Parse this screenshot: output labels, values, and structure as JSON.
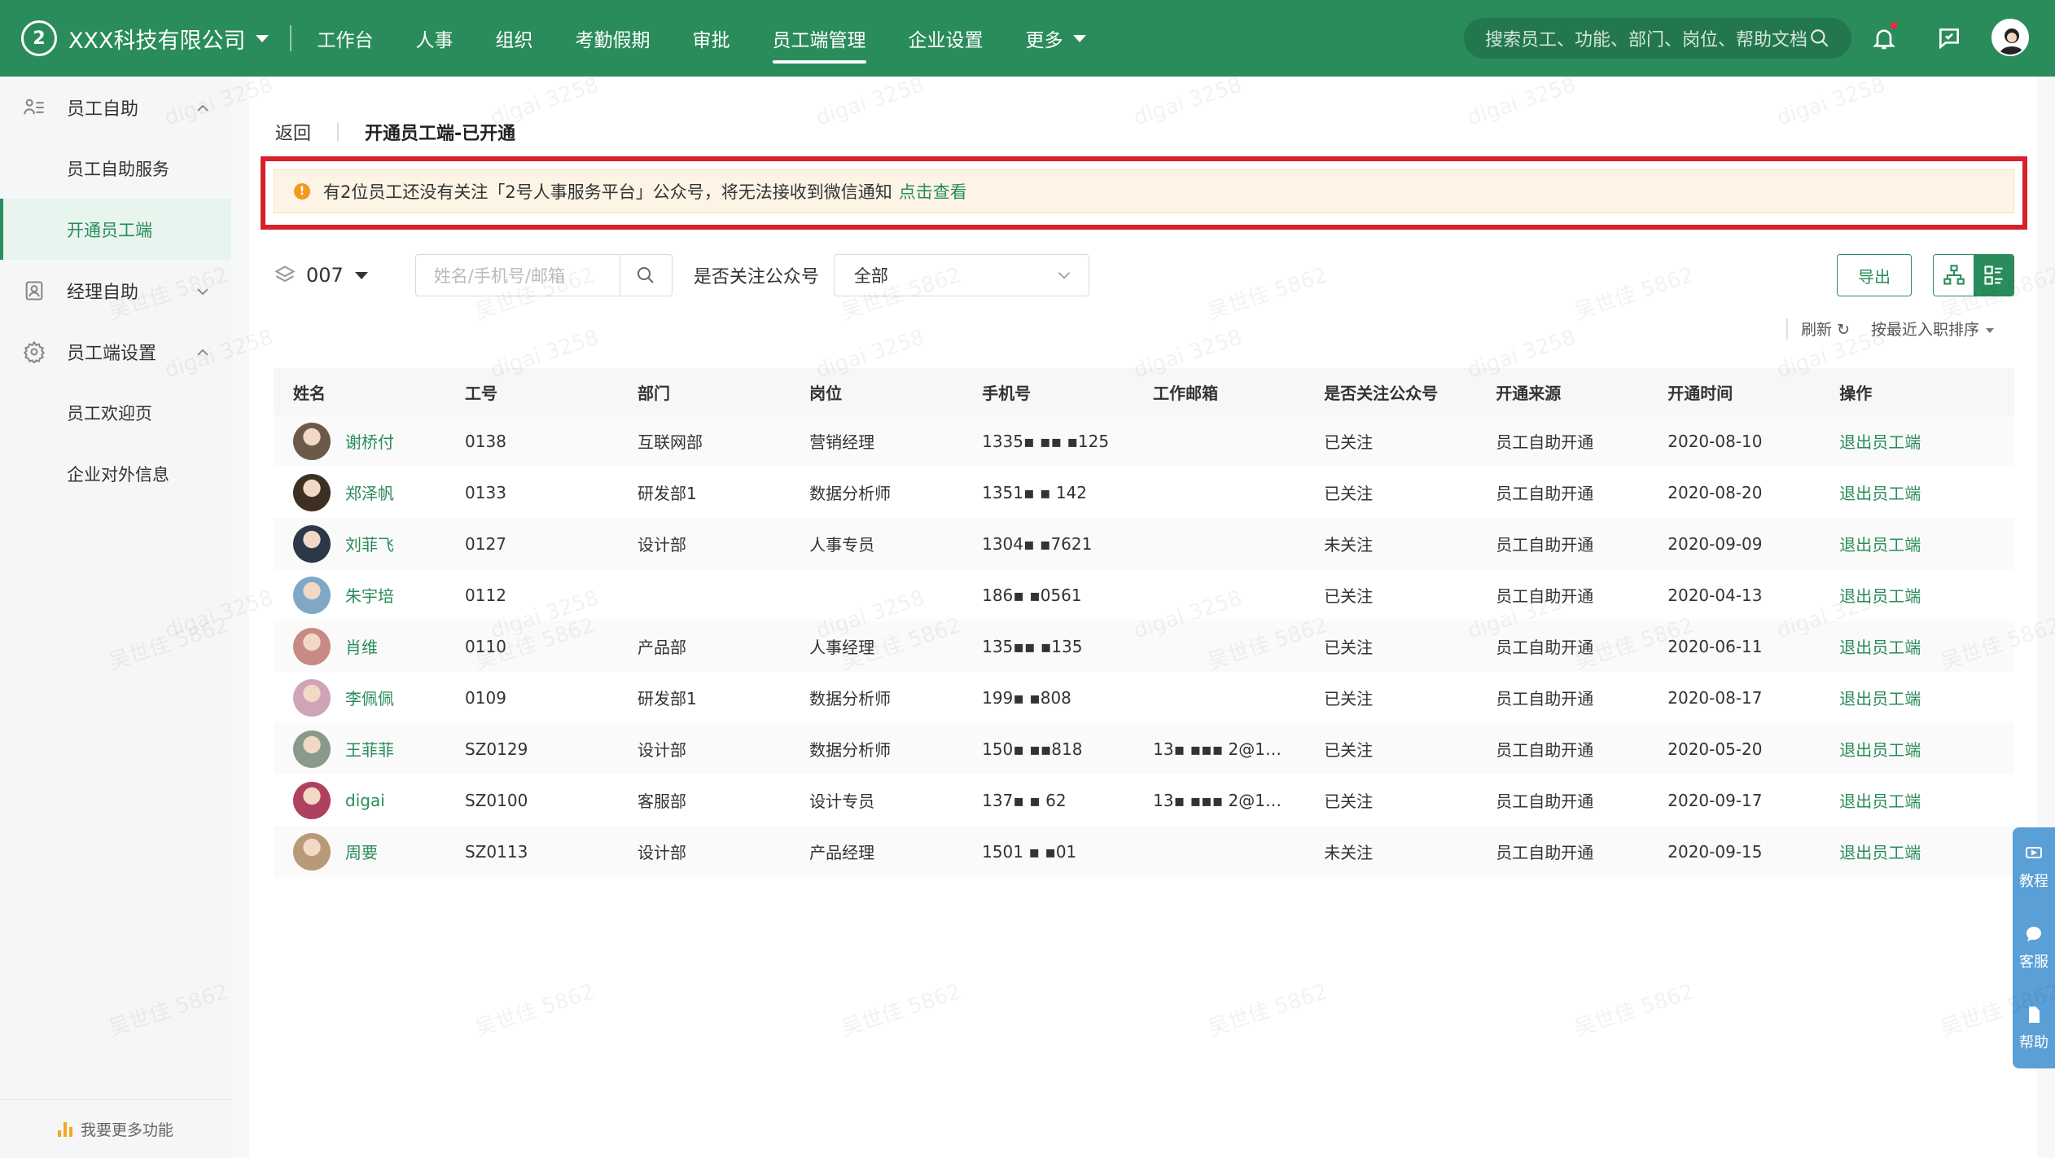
{
  "topbar": {
    "logo_text": "2",
    "company": "XXX科技有限公司",
    "nav": [
      "工作台",
      "人事",
      "组织",
      "考勤假期",
      "审批",
      "员工端管理",
      "企业设置",
      "更多"
    ],
    "active_nav": "员工端管理",
    "search_placeholder": "搜索员工、功能、部门、岗位、帮助文档"
  },
  "sidebar": {
    "groups": [
      {
        "label": "员工自助",
        "icon": "user-list-icon",
        "expanded": true,
        "items": [
          "员工自助服务",
          "开通员工端"
        ]
      },
      {
        "label": "经理自助",
        "icon": "manager-icon",
        "expanded": false,
        "items": []
      },
      {
        "label": "员工端设置",
        "icon": "gear-icon",
        "expanded": true,
        "items": [
          "员工欢迎页",
          "企业对外信息"
        ]
      }
    ],
    "active_item": "开通员工端",
    "bottom_link": "我要更多功能"
  },
  "page": {
    "back": "返回",
    "title": "开通员工端-已开通",
    "alert_text": "有2位员工还没有关注「2号人事服务平台」公众号，将无法接收到微信通知",
    "alert_link": "点击查看",
    "dept_value": "007",
    "name_placeholder": "姓名/手机号/邮箱",
    "follow_label": "是否关注公众号",
    "follow_value": "全部",
    "export_label": "导出",
    "refresh_label": "刷新",
    "sort_label": "按最近入职排序"
  },
  "table": {
    "headers": [
      "姓名",
      "工号",
      "部门",
      "岗位",
      "手机号",
      "工作邮箱",
      "是否关注公众号",
      "开通来源",
      "开通时间",
      "操作"
    ],
    "rows": [
      {
        "name": "谢桥付",
        "id": "0138",
        "dept": "互联网部",
        "post": "营销经理",
        "phone": "1335▪ ▪▪ ▪125",
        "email": "",
        "follow": "已关注",
        "source": "员工自助开通",
        "date": "2020-08-10",
        "op": "退出员工端",
        "avatar": "#6b5a4a"
      },
      {
        "name": "郑泽帆",
        "id": "0133",
        "dept": "研发部1",
        "post": "数据分析师",
        "phone": "1351▪ ▪ 142",
        "email": "",
        "follow": "已关注",
        "source": "员工自助开通",
        "date": "2020-08-20",
        "op": "退出员工端",
        "avatar": "#3d2f22"
      },
      {
        "name": "刘菲飞",
        "id": "0127",
        "dept": "设计部",
        "post": "人事专员",
        "phone": "1304▪ ▪7621",
        "email": "",
        "follow": "未关注",
        "source": "员工自助开通",
        "date": "2020-09-09",
        "op": "退出员工端",
        "avatar": "#2c3848"
      },
      {
        "name": "朱宇培",
        "id": "0112",
        "dept": "",
        "post": "",
        "phone": "186▪ ▪0561",
        "email": "",
        "follow": "已关注",
        "source": "员工自助开通",
        "date": "2020-04-13",
        "op": "退出员工端",
        "avatar": "#7fa8c4"
      },
      {
        "name": "肖维",
        "id": "0110",
        "dept": "产品部",
        "post": "人事经理",
        "phone": "135▪▪ ▪135",
        "email": "",
        "follow": "已关注",
        "source": "员工自助开通",
        "date": "2020-06-11",
        "op": "退出员工端",
        "avatar": "#c98a86"
      },
      {
        "name": "李佩佩",
        "id": "0109",
        "dept": "研发部1",
        "post": "数据分析师",
        "phone": "199▪ ▪808",
        "email": "",
        "follow": "已关注",
        "source": "员工自助开通",
        "date": "2020-08-17",
        "op": "退出员工端",
        "avatar": "#cfa4b8"
      },
      {
        "name": "王菲菲",
        "id": "SZ0129",
        "dept": "设计部",
        "post": "数据分析师",
        "phone": "150▪ ▪▪818",
        "email": "13▪ ▪▪▪ 2@1…",
        "follow": "已关注",
        "source": "员工自助开通",
        "date": "2020-05-20",
        "op": "退出员工端",
        "avatar": "#8a9a8a"
      },
      {
        "name": "digai",
        "id": "SZ0100",
        "dept": "客服部",
        "post": "设计专员",
        "phone": "137▪ ▪ 62",
        "email": "13▪ ▪▪▪ 2@1…",
        "follow": "已关注",
        "source": "员工自助开通",
        "date": "2020-09-17",
        "op": "退出员工端",
        "avatar": "#b04060"
      },
      {
        "name": "周要",
        "id": "SZ0113",
        "dept": "设计部",
        "post": "产品经理",
        "phone": "1501 ▪ ▪01",
        "email": "",
        "follow": "未关注",
        "source": "员工自助开通",
        "date": "2020-09-15",
        "op": "退出员工端",
        "avatar": "#b89a78"
      }
    ]
  },
  "float_tools": [
    "教程",
    "客服",
    "帮助"
  ],
  "watermarks": [
    "digai 3258",
    "吴世佳 5862"
  ],
  "colors": {
    "brand": "#2a8c5a",
    "alert_border": "#d8202a",
    "alert_bg": "#fdf4e6",
    "float": "#5a9fd6"
  }
}
